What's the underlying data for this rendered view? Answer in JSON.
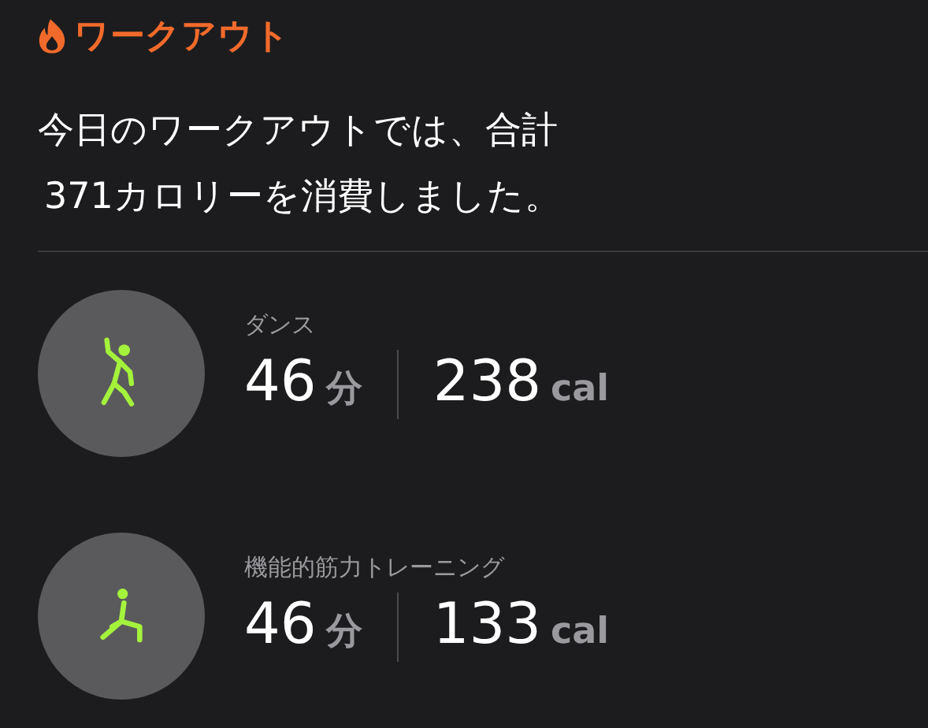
{
  "header": {
    "title": "ワークアウト"
  },
  "summary": {
    "lines": [
      "今日のワークアウトでは、合計",
      "371カロリーを消費しました。"
    ]
  },
  "workouts": [
    {
      "kind": "dance",
      "name": "ダンス",
      "duration": "46",
      "duration_unit": "分",
      "calories": "238",
      "calories_unit": "cal"
    },
    {
      "kind": "strength",
      "name": "機能的筋力トレーニング",
      "duration": "46",
      "duration_unit": "分",
      "calories": "133",
      "calories_unit": "cal"
    }
  ]
}
